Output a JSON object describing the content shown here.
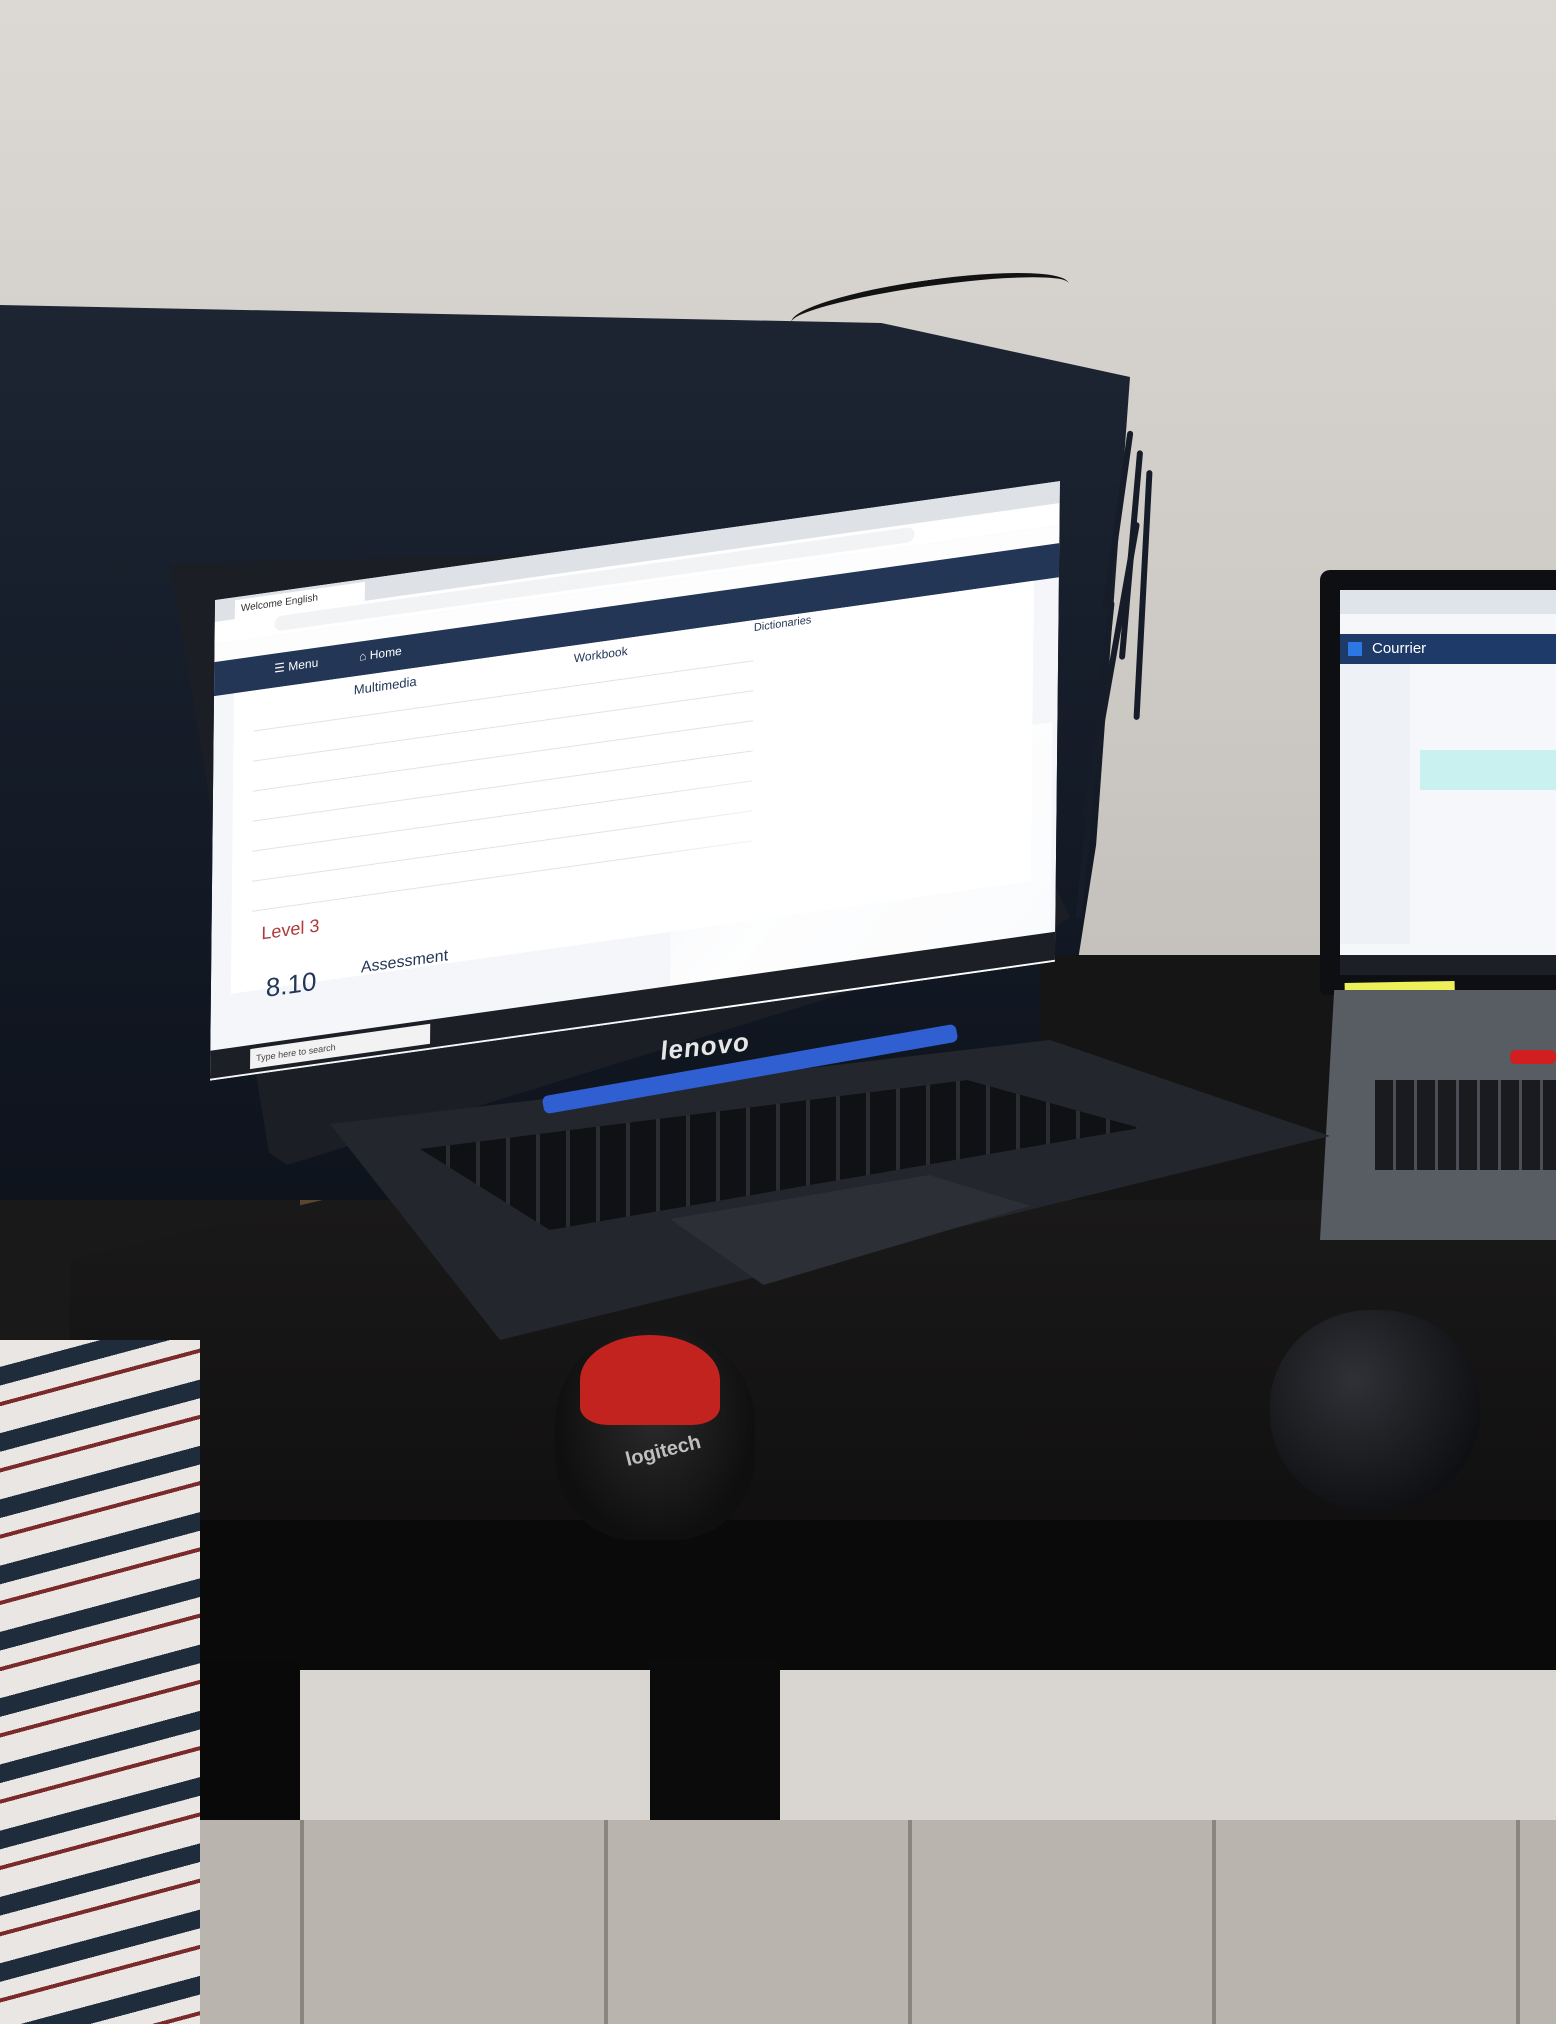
{
  "scene": {
    "left_laptop": {
      "brand": "lenovo",
      "browser": {
        "active_tab": "Welcome English",
        "nav": {
          "menu": "☰ Menu",
          "home": "⌂ Home"
        },
        "tabs": [
          "Multimedia",
          "Workbook",
          "Dictionaries"
        ],
        "level": "Level 3",
        "score": "8.10",
        "section": "Assessment",
        "search_placeholder": "Type here to search"
      }
    },
    "right_laptop": {
      "app_title": "Courrier"
    },
    "mouse_left": {
      "brand": "logitech",
      "accent_color": "#c3231f"
    },
    "mouse_right": {
      "color": "#111214"
    }
  }
}
